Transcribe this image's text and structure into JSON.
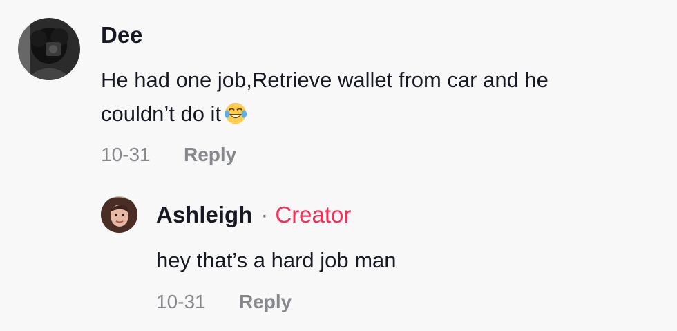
{
  "comment": {
    "author": "Dee",
    "text_line1": "He had one job,Retrieve wallet from car and he",
    "text_line2": "couldn’t do it",
    "emoji_icon": "face-with-tears-of-joy-icon",
    "date": "10-31",
    "reply_label": "Reply"
  },
  "reply": {
    "author": "Ashleigh",
    "separator": "·",
    "badge": "Creator",
    "text": "hey that’s a hard job man",
    "date": "10-31",
    "reply_label": "Reply"
  },
  "colors": {
    "background": "#f8f8f8",
    "text": "#161823",
    "muted": "#8a8b91",
    "creator": "#fe2c55"
  }
}
